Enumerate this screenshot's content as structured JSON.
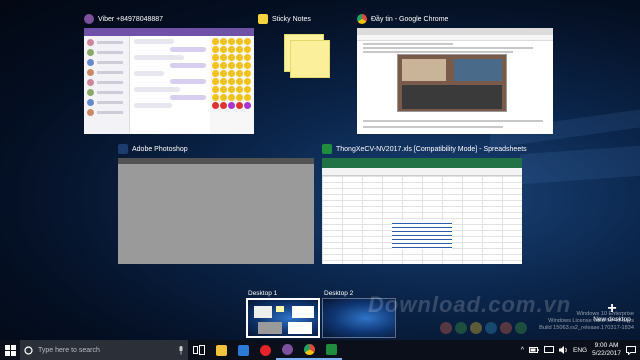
{
  "windows": [
    {
      "id": "viber",
      "title": "Viber +84978048887",
      "icon": "viber-icon",
      "color": "#7b519d"
    },
    {
      "id": "sticky",
      "title": "Sticky Notes",
      "icon": "sticky-notes-icon",
      "color": "#f5d33d"
    },
    {
      "id": "chrome",
      "title": "Đầy tin - Google Chrome",
      "icon": "chrome-icon",
      "color": "#dd4b39"
    },
    {
      "id": "photoshop",
      "title": "Adobe Photoshop",
      "icon": "photoshop-icon",
      "color": "#1c3b6e"
    },
    {
      "id": "spreadsheet",
      "title": "ThongXeCV-NV2017.xls [Compatibility Mode] - Spreadsheets",
      "icon": "spreadsheets-icon",
      "color": "#1e8e3e"
    }
  ],
  "desktops": [
    {
      "label": "Desktop 1",
      "selected": true
    },
    {
      "label": "Desktop 2",
      "selected": false
    }
  ],
  "new_desktop": {
    "symbol": "+",
    "label": "New desktop"
  },
  "watermark": "Download.com.vn",
  "activation_note": [
    "Windows 10 Enterprise",
    "Windows License valid for 45 days",
    "Build 15063.rs2_release.170317-1834"
  ],
  "taskbar": {
    "search_placeholder": "Type here to search",
    "apps": [
      {
        "name": "task-view",
        "color": "#ffffff"
      },
      {
        "name": "file-explorer",
        "color": "#f2c43b"
      },
      {
        "name": "store",
        "color": "#2d7ad6"
      },
      {
        "name": "opera",
        "color": "#e3242b"
      },
      {
        "name": "viber",
        "color": "#7b519d"
      },
      {
        "name": "chrome",
        "color": "#dd4b39"
      },
      {
        "name": "spreadsheets",
        "color": "#1e8e3e"
      }
    ],
    "tray_up": "^",
    "language": "ENG",
    "time": "9:00 AM",
    "date": "5/22/2017"
  },
  "colors": {
    "taskbar": "#0b0f1a",
    "accent": "#7fb3f5"
  }
}
